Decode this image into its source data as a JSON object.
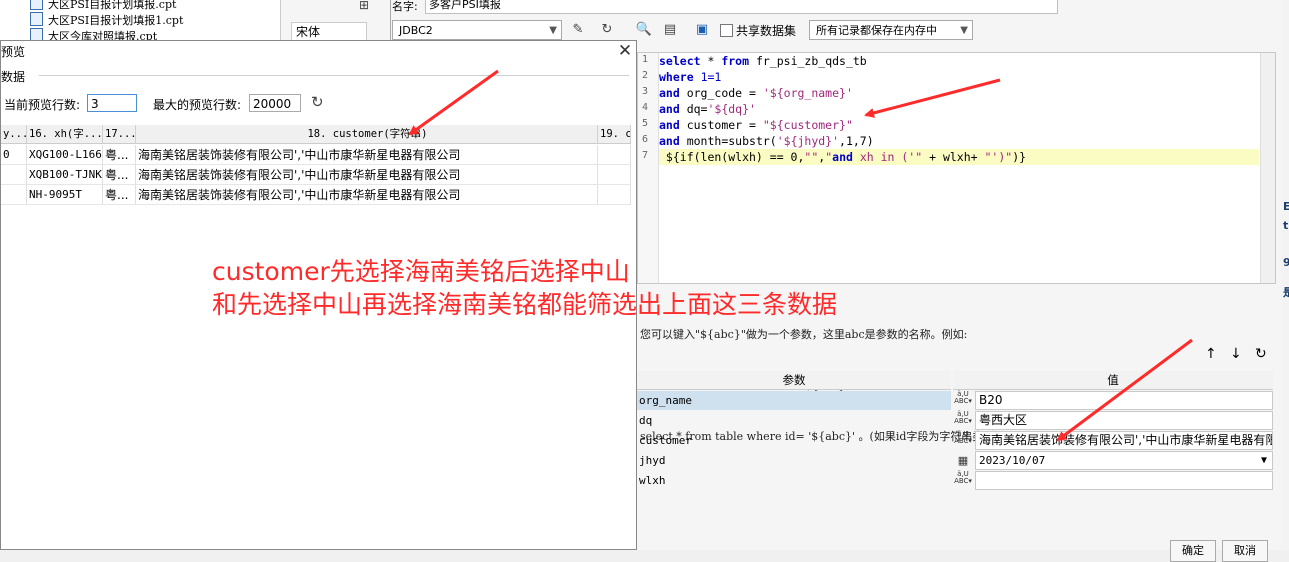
{
  "background_ide": {
    "tree_items": [
      "大区PSI目报计划填报.cpt",
      "大区PSI目报计划填报1.cpt",
      "大区今库对照填报.cpt"
    ],
    "font_combo": "宋体"
  },
  "sql_dialog": {
    "name_label": "名字:",
    "name_value": "多客户PSI填报",
    "datasource": "JDBC2",
    "share_dataset_label": "共享数据集",
    "storage_mode": "所有记录都保存在内存中",
    "sql_lines": [
      "select * from fr_psi_zb_qds_tb",
      "where 1=1",
      "and org_code = '${org_name}'",
      "and dq='${dq}'",
      "and customer = \"${customer}\"",
      "and month=substr('${jhyd}',1,7)",
      " ${if(len(wlxh) == 0,\"\",\"and xh in ('\" + wlxh+ \"')\")}"
    ],
    "hint_lines": [
      "您可以键入\"${abc}\"做为一个参数，这里abc是参数的名称。例如:",
      "select * from table where id=${abc}。",
      "select * from table where id= '${abc}' 。(如果id字段为字符串类型)"
    ],
    "param_header": "参数",
    "value_header": "值",
    "params": [
      {
        "name": "org_name",
        "value": "B20"
      },
      {
        "name": "dq",
        "value": "粤西大区"
      },
      {
        "name": "customer",
        "value": "海南美铭居装饰装修有限公司','中山市康华新星电器有限公司"
      },
      {
        "name": "jhyd",
        "value": "2023/10/07"
      },
      {
        "name": "wlxh",
        "value": ""
      }
    ],
    "ok_button": "确定",
    "cancel_button": "取消"
  },
  "preview": {
    "title": "预览",
    "group_label": "数据",
    "current_rows_label": "当前预览行数:",
    "current_rows_value": "3",
    "max_rows_label": "最大的预览行数:",
    "max_rows_value": "20000",
    "columns": [
      "y...",
      "16. xh(字...",
      "17...",
      "18. customer(字符串)",
      "19. c"
    ],
    "rows": [
      [
        "0",
        "XQG100-L166",
        "粤...",
        "海南美铭居装饰装修有限公司','中山市康华新星电器有限公司",
        ""
      ],
      [
        "",
        "XQB100-TJNKJ",
        "粤...",
        "海南美铭居装饰装修有限公司','中山市康华新星电器有限公司",
        ""
      ],
      [
        "",
        "NH-9095T",
        "粤...",
        "海南美铭居装饰装修有限公司','中山市康华新星电器有限公司",
        ""
      ]
    ]
  },
  "annotation": {
    "line1": "customer先选择海南美铭后选择中山",
    "line2": "和先选择中山再选择海南美铭都能筛选出上面这三条数据",
    "color": "#ff2a2a"
  },
  "right_edge_chars": [
    "E",
    "t",
    "9",
    "是"
  ]
}
